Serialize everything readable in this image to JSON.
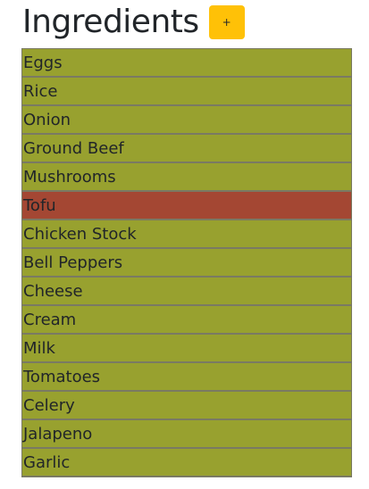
{
  "header": {
    "title": "Ingredients",
    "add_label": "+"
  },
  "colors": {
    "item_default": "#98a12f",
    "item_highlighted": "#a44733",
    "add_button": "#ffc107"
  },
  "ingredients": [
    {
      "name": "Eggs",
      "highlighted": false
    },
    {
      "name": "Rice",
      "highlighted": false
    },
    {
      "name": "Onion",
      "highlighted": false
    },
    {
      "name": "Ground Beef",
      "highlighted": false
    },
    {
      "name": "Mushrooms",
      "highlighted": false
    },
    {
      "name": "Tofu",
      "highlighted": true
    },
    {
      "name": "Chicken Stock",
      "highlighted": false
    },
    {
      "name": "Bell Peppers",
      "highlighted": false
    },
    {
      "name": "Cheese",
      "highlighted": false
    },
    {
      "name": "Cream",
      "highlighted": false
    },
    {
      "name": "Milk",
      "highlighted": false
    },
    {
      "name": "Tomatoes",
      "highlighted": false
    },
    {
      "name": "Celery",
      "highlighted": false
    },
    {
      "name": "Jalapeno",
      "highlighted": false
    },
    {
      "name": "Garlic",
      "highlighted": false
    }
  ]
}
